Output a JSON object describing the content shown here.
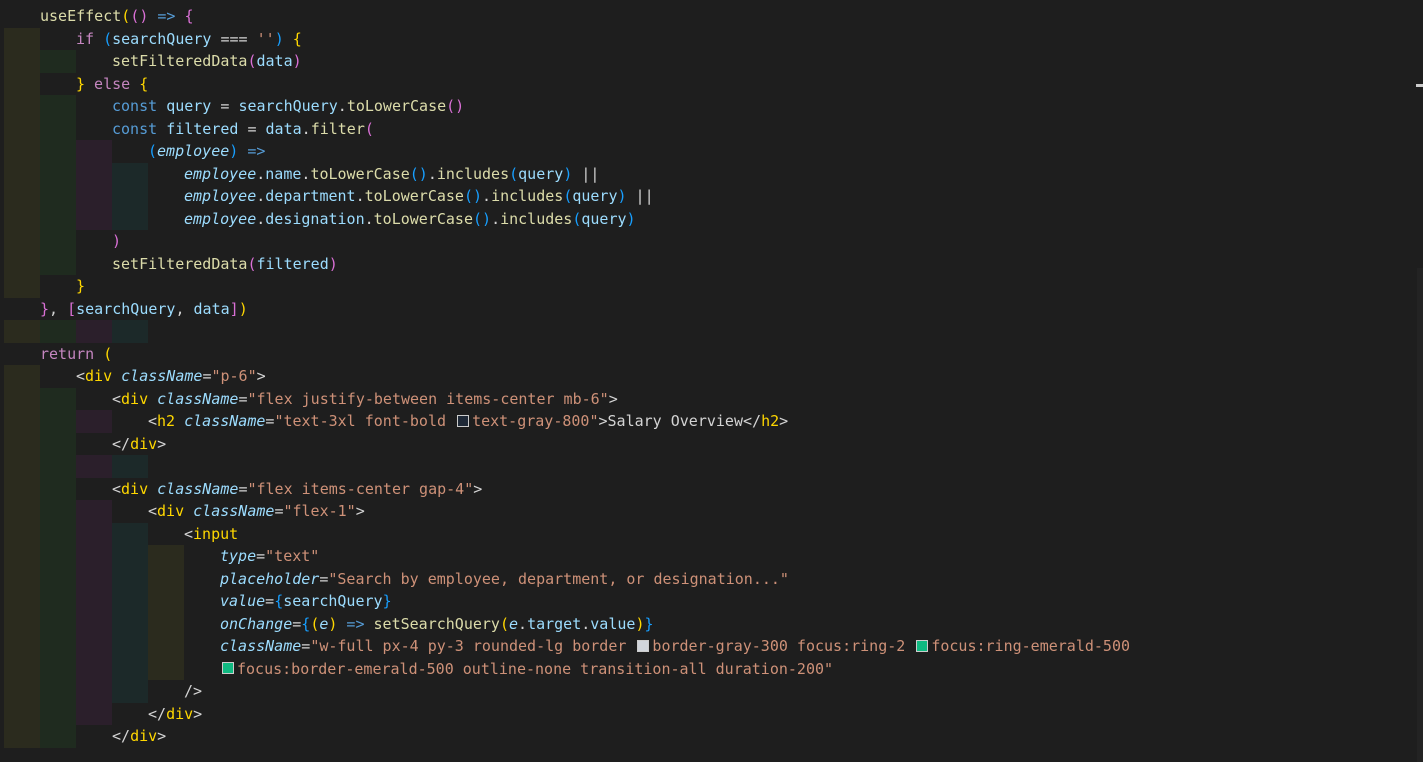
{
  "editor": {
    "lines": [
      {
        "indent": 0,
        "tokens": [
          {
            "t": "useEffect",
            "c": "f"
          },
          {
            "t": "(",
            "c": "b1"
          },
          {
            "t": "()",
            "c": "b2"
          },
          {
            "t": " => ",
            "c": "kb"
          },
          {
            "t": "{",
            "c": "b2"
          }
        ]
      },
      {
        "indent": 1,
        "tokens": [
          {
            "t": "if ",
            "c": "k"
          },
          {
            "t": "(",
            "c": "b3"
          },
          {
            "t": "searchQuery",
            "c": "v"
          },
          {
            "t": " === ",
            "c": "o"
          },
          {
            "t": "''",
            "c": "s"
          },
          {
            "t": ")",
            "c": "b3"
          },
          {
            "t": " ",
            "c": "o"
          },
          {
            "t": "{",
            "c": "b1"
          }
        ]
      },
      {
        "indent": 2,
        "tokens": [
          {
            "t": "setFilteredData",
            "c": "f"
          },
          {
            "t": "(",
            "c": "b2"
          },
          {
            "t": "data",
            "c": "v"
          },
          {
            "t": ")",
            "c": "b2"
          }
        ]
      },
      {
        "indent": 1,
        "tokens": [
          {
            "t": "}",
            "c": "b1"
          },
          {
            "t": " else ",
            "c": "k"
          },
          {
            "t": "{",
            "c": "b1"
          }
        ]
      },
      {
        "indent": 2,
        "tokens": [
          {
            "t": "const ",
            "c": "kb"
          },
          {
            "t": "query",
            "c": "v"
          },
          {
            "t": " = ",
            "c": "o"
          },
          {
            "t": "searchQuery",
            "c": "v"
          },
          {
            "t": ".",
            "c": "o"
          },
          {
            "t": "toLowerCase",
            "c": "f"
          },
          {
            "t": "()",
            "c": "b2"
          }
        ]
      },
      {
        "indent": 2,
        "tokens": [
          {
            "t": "const ",
            "c": "kb"
          },
          {
            "t": "filtered",
            "c": "v"
          },
          {
            "t": " = ",
            "c": "o"
          },
          {
            "t": "data",
            "c": "v"
          },
          {
            "t": ".",
            "c": "o"
          },
          {
            "t": "filter",
            "c": "f"
          },
          {
            "t": "(",
            "c": "b2"
          }
        ]
      },
      {
        "indent": 3,
        "tokens": [
          {
            "t": "(",
            "c": "b3"
          },
          {
            "t": "employee",
            "c": "v",
            "i": true
          },
          {
            "t": ")",
            "c": "b3"
          },
          {
            "t": " =>",
            "c": "kb"
          }
        ]
      },
      {
        "indent": 4,
        "tokens": [
          {
            "t": "employee",
            "c": "v",
            "i": true
          },
          {
            "t": ".",
            "c": "o"
          },
          {
            "t": "name",
            "c": "v"
          },
          {
            "t": ".",
            "c": "o"
          },
          {
            "t": "toLowerCase",
            "c": "f"
          },
          {
            "t": "()",
            "c": "b3"
          },
          {
            "t": ".",
            "c": "o"
          },
          {
            "t": "includes",
            "c": "f"
          },
          {
            "t": "(",
            "c": "b3"
          },
          {
            "t": "query",
            "c": "v"
          },
          {
            "t": ")",
            "c": "b3"
          },
          {
            "t": " ||",
            "c": "o"
          }
        ]
      },
      {
        "indent": 4,
        "tokens": [
          {
            "t": "employee",
            "c": "v",
            "i": true
          },
          {
            "t": ".",
            "c": "o"
          },
          {
            "t": "department",
            "c": "v"
          },
          {
            "t": ".",
            "c": "o"
          },
          {
            "t": "toLowerCase",
            "c": "f"
          },
          {
            "t": "()",
            "c": "b3"
          },
          {
            "t": ".",
            "c": "o"
          },
          {
            "t": "includes",
            "c": "f"
          },
          {
            "t": "(",
            "c": "b3"
          },
          {
            "t": "query",
            "c": "v"
          },
          {
            "t": ")",
            "c": "b3"
          },
          {
            "t": " ||",
            "c": "o"
          }
        ]
      },
      {
        "indent": 4,
        "tokens": [
          {
            "t": "employee",
            "c": "v",
            "i": true
          },
          {
            "t": ".",
            "c": "o"
          },
          {
            "t": "designation",
            "c": "v"
          },
          {
            "t": ".",
            "c": "o"
          },
          {
            "t": "toLowerCase",
            "c": "f"
          },
          {
            "t": "()",
            "c": "b3"
          },
          {
            "t": ".",
            "c": "o"
          },
          {
            "t": "includes",
            "c": "f"
          },
          {
            "t": "(",
            "c": "b3"
          },
          {
            "t": "query",
            "c": "v"
          },
          {
            "t": ")",
            "c": "b3"
          }
        ]
      },
      {
        "indent": 2,
        "tokens": [
          {
            "t": ")",
            "c": "b2"
          }
        ]
      },
      {
        "indent": 2,
        "tokens": [
          {
            "t": "setFilteredData",
            "c": "f"
          },
          {
            "t": "(",
            "c": "b2"
          },
          {
            "t": "filtered",
            "c": "v"
          },
          {
            "t": ")",
            "c": "b2"
          }
        ]
      },
      {
        "indent": 1,
        "tokens": [
          {
            "t": "}",
            "c": "b1"
          }
        ]
      },
      {
        "indent": 0,
        "tokens": [
          {
            "t": "}",
            "c": "b2"
          },
          {
            "t": ", ",
            "c": "o"
          },
          {
            "t": "[",
            "c": "b2"
          },
          {
            "t": "searchQuery",
            "c": "v"
          },
          {
            "t": ", ",
            "c": "o"
          },
          {
            "t": "data",
            "c": "v"
          },
          {
            "t": "]",
            "c": "b2"
          },
          {
            "t": ")",
            "c": "b1"
          }
        ]
      },
      {
        "indent": 0,
        "tokens": []
      },
      {
        "indent": 0,
        "tokens": [
          {
            "t": "return ",
            "c": "k"
          },
          {
            "t": "(",
            "c": "b1"
          }
        ]
      },
      {
        "indent": 1,
        "tokens": [
          {
            "t": "<",
            "c": "o"
          },
          {
            "t": "div",
            "c": "tag"
          },
          {
            "t": " ",
            "c": "o"
          },
          {
            "t": "className",
            "c": "attr"
          },
          {
            "t": "=",
            "c": "o"
          },
          {
            "t": "\"p-6\"",
            "c": "s"
          },
          {
            "t": ">",
            "c": "o"
          }
        ]
      },
      {
        "indent": 2,
        "tokens": [
          {
            "t": "<",
            "c": "o"
          },
          {
            "t": "div",
            "c": "tag"
          },
          {
            "t": " ",
            "c": "o"
          },
          {
            "t": "className",
            "c": "attr"
          },
          {
            "t": "=",
            "c": "o"
          },
          {
            "t": "\"flex justify-between items-center mb-6\"",
            "c": "s"
          },
          {
            "t": ">",
            "c": "o"
          }
        ]
      },
      {
        "indent": 3,
        "tokens": [
          {
            "t": "<",
            "c": "o"
          },
          {
            "t": "h2",
            "c": "tag"
          },
          {
            "t": " ",
            "c": "o"
          },
          {
            "t": "className",
            "c": "attr"
          },
          {
            "t": "=",
            "c": "o"
          },
          {
            "t": "\"text-3xl font-bold ",
            "c": "s"
          },
          {
            "sw": "#1f2937"
          },
          {
            "t": "text-gray-800\"",
            "c": "s"
          },
          {
            "t": ">",
            "c": "o"
          },
          {
            "t": "Salary Overview",
            "c": "text"
          },
          {
            "t": "</",
            "c": "o"
          },
          {
            "t": "h2",
            "c": "tag"
          },
          {
            "t": ">",
            "c": "o"
          }
        ]
      },
      {
        "indent": 2,
        "tokens": [
          {
            "t": "</",
            "c": "o"
          },
          {
            "t": "div",
            "c": "tag"
          },
          {
            "t": ">",
            "c": "o"
          }
        ]
      },
      {
        "indent": 0,
        "tokens": []
      },
      {
        "indent": 2,
        "tokens": [
          {
            "t": "<",
            "c": "o"
          },
          {
            "t": "div",
            "c": "tag"
          },
          {
            "t": " ",
            "c": "o"
          },
          {
            "t": "className",
            "c": "attr"
          },
          {
            "t": "=",
            "c": "o"
          },
          {
            "t": "\"flex items-center gap-4\"",
            "c": "s"
          },
          {
            "t": ">",
            "c": "o"
          }
        ]
      },
      {
        "indent": 3,
        "tokens": [
          {
            "t": "<",
            "c": "o"
          },
          {
            "t": "div",
            "c": "tag"
          },
          {
            "t": " ",
            "c": "o"
          },
          {
            "t": "className",
            "c": "attr"
          },
          {
            "t": "=",
            "c": "o"
          },
          {
            "t": "\"flex-1\"",
            "c": "s"
          },
          {
            "t": ">",
            "c": "o"
          }
        ]
      },
      {
        "indent": 4,
        "tokens": [
          {
            "t": "<",
            "c": "o"
          },
          {
            "t": "input",
            "c": "tag"
          }
        ]
      },
      {
        "indent": 5,
        "tokens": [
          {
            "t": "type",
            "c": "attr"
          },
          {
            "t": "=",
            "c": "o"
          },
          {
            "t": "\"text\"",
            "c": "s"
          }
        ]
      },
      {
        "indent": 5,
        "tokens": [
          {
            "t": "placeholder",
            "c": "attr"
          },
          {
            "t": "=",
            "c": "o"
          },
          {
            "t": "\"Search by employee, department, or designation...\"",
            "c": "s"
          }
        ]
      },
      {
        "indent": 5,
        "tokens": [
          {
            "t": "value",
            "c": "attr"
          },
          {
            "t": "=",
            "c": "o"
          },
          {
            "t": "{",
            "c": "b3"
          },
          {
            "t": "searchQuery",
            "c": "v"
          },
          {
            "t": "}",
            "c": "b3"
          }
        ]
      },
      {
        "indent": 5,
        "tokens": [
          {
            "t": "onChange",
            "c": "attr"
          },
          {
            "t": "=",
            "c": "o"
          },
          {
            "t": "{",
            "c": "b3"
          },
          {
            "t": "(",
            "c": "b1"
          },
          {
            "t": "e",
            "c": "v",
            "i": true
          },
          {
            "t": ")",
            "c": "b1"
          },
          {
            "t": " => ",
            "c": "kb"
          },
          {
            "t": "setSearchQuery",
            "c": "f"
          },
          {
            "t": "(",
            "c": "b1"
          },
          {
            "t": "e",
            "c": "v",
            "i": true
          },
          {
            "t": ".",
            "c": "o"
          },
          {
            "t": "target",
            "c": "v"
          },
          {
            "t": ".",
            "c": "o"
          },
          {
            "t": "value",
            "c": "v"
          },
          {
            "t": ")",
            "c": "b1"
          },
          {
            "t": "}",
            "c": "b3"
          }
        ]
      },
      {
        "indent": 5,
        "tokens": [
          {
            "t": "className",
            "c": "attr"
          },
          {
            "t": "=",
            "c": "o"
          },
          {
            "t": "\"w-full px-4 py-3 rounded-lg border ",
            "c": "s"
          },
          {
            "sw": "#d1d5db"
          },
          {
            "t": "border-gray-300 focus:ring-2 ",
            "c": "s"
          },
          {
            "sw": "#10b981"
          },
          {
            "t": "focus:ring-emerald-500",
            "c": "s"
          }
        ]
      },
      {
        "indent": 5,
        "tokens": [
          {
            "sw": "#10b981"
          },
          {
            "t": "focus:border-emerald-500 outline-none transition-all duration-200\"",
            "c": "s"
          }
        ]
      },
      {
        "indent": 4,
        "tokens": [
          {
            "t": "/>",
            "c": "o"
          }
        ]
      },
      {
        "indent": 3,
        "tokens": [
          {
            "t": "</",
            "c": "o"
          },
          {
            "t": "div",
            "c": "tag"
          },
          {
            "t": ">",
            "c": "o"
          }
        ]
      },
      {
        "indent": 2,
        "tokens": [
          {
            "t": "</",
            "c": "o"
          },
          {
            "t": "div",
            "c": "tag"
          },
          {
            "t": ">",
            "c": "o"
          }
        ]
      }
    ],
    "guide_colors": [
      "#2b2b1e",
      "#1f2b1f",
      "#2b1f2b",
      "#1c2929",
      "#2b2b1e"
    ]
  }
}
